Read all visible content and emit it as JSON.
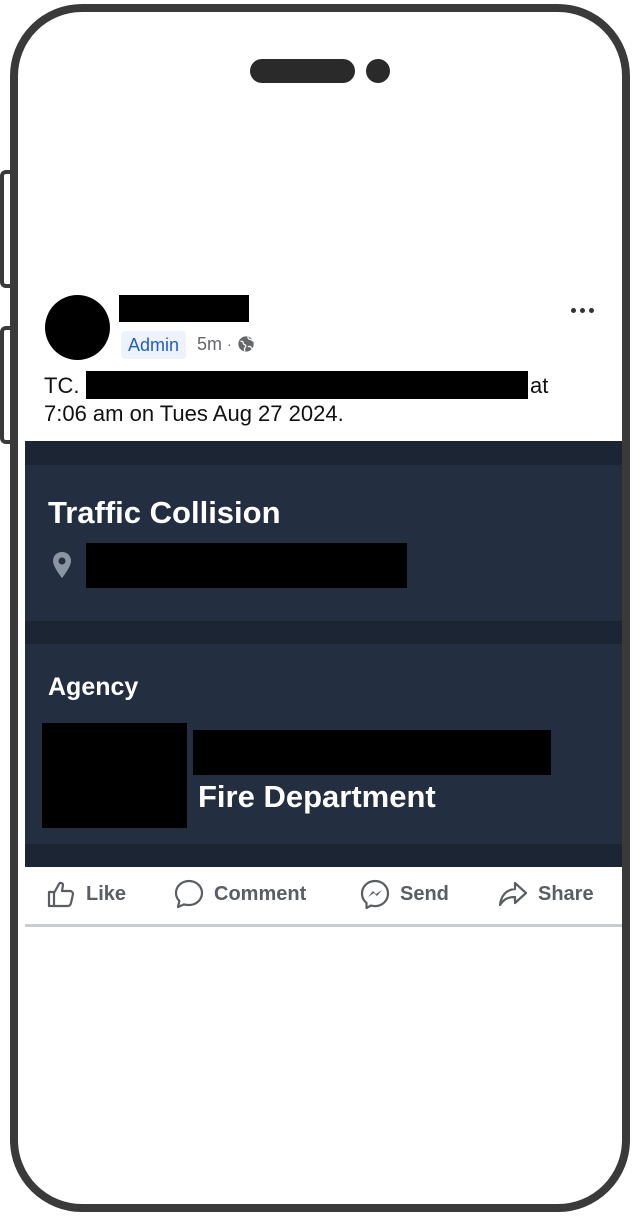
{
  "post": {
    "badge": "Admin",
    "time": "5m",
    "separator": "·",
    "text_prefix": "TC.",
    "text_line1_end": "at",
    "text_line2": "7:06 am on Tues Aug 27 2024."
  },
  "card": {
    "title": "Traffic Collision",
    "agency_label": "Agency",
    "agency_name_suffix": "Fire Department"
  },
  "actions": {
    "like": "Like",
    "comment": "Comment",
    "send": "Send",
    "share": "Share"
  },
  "icons": {
    "globe": "globe-icon",
    "more": "more-options-icon",
    "location": "location-pin-icon",
    "like": "thumbs-up-icon",
    "comment": "comment-bubble-icon",
    "send": "messenger-icon",
    "share": "share-arrow-icon"
  },
  "colors": {
    "card_bg": "#1c2533",
    "card_panel": "#232e40",
    "admin_badge_text": "#1f5ec8",
    "action_text": "#5a5d62"
  }
}
